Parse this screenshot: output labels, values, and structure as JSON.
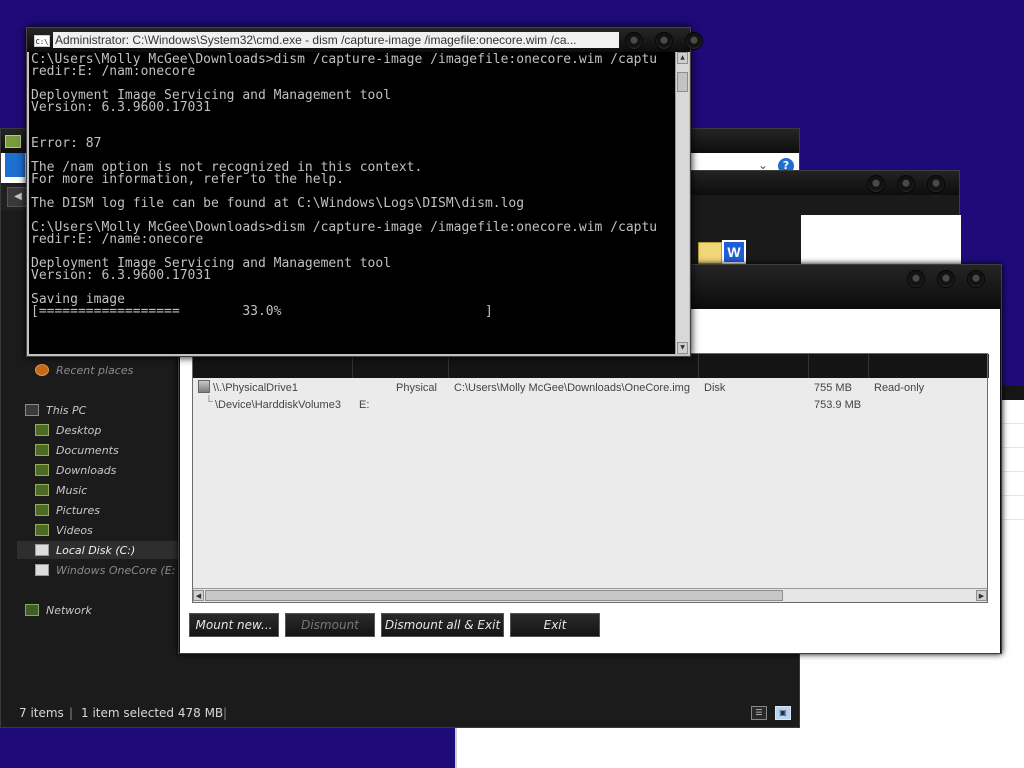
{
  "cmd": {
    "title": "Administrator: C:\\Windows\\System32\\cmd.exe - dism  /capture-image /imagefile:onecore.wim /ca...",
    "icon_label": "C:\\",
    "lines": [
      "C:\\Users\\Molly McGee\\Downloads>dism /capture-image /imagefile:onecore.wim /captu",
      "redir:E: /nam:onecore",
      "",
      "Deployment Image Servicing and Management tool",
      "Version: 6.3.9600.17031",
      "",
      "",
      "Error: 87",
      "",
      "The /nam option is not recognized in this context.",
      "For more information, refer to the help.",
      "",
      "The DISM log file can be found at C:\\Windows\\Logs\\DISM\\dism.log",
      "",
      "C:\\Users\\Molly McGee\\Downloads>dism /capture-image /imagefile:onecore.wim /captu",
      "redir:E: /name:onecore",
      "",
      "Deployment Image Servicing and Management tool",
      "Version: 6.3.9600.17031",
      "",
      "Saving image",
      "[==================        33.0%                          ]"
    ],
    "progress": 0.33
  },
  "explorer": {
    "ribbon_help": "?",
    "nav": {
      "recent": "Recent places",
      "this_pc": "This PC",
      "desktop": "Desktop",
      "documents": "Documents",
      "downloads": "Downloads",
      "music": "Music",
      "pictures": "Pictures",
      "videos": "Videos",
      "local_disk": "Local Disk (C:)",
      "onecore": "Windows OneCore (E:",
      "network": "Network"
    },
    "status": {
      "items": "7 items",
      "selected": "1 item selected  478 MB"
    }
  },
  "mount": {
    "rows": [
      {
        "name": "\\\\.\\PhysicalDrive1",
        "type": "Physical",
        "path": "C:\\Users\\Molly McGee\\Downloads\\OneCore.img",
        "kind": "Disk",
        "size": "755 MB",
        "mode": "Read-only"
      },
      {
        "name": "\\Device\\HarddiskVolume3",
        "drive": "E:",
        "size": "753.9 MB"
      }
    ],
    "buttons": {
      "mount_new": "Mount new...",
      "dismount": "Dismount",
      "dismount_all": "Dismount all & Exit",
      "exit": "Exit"
    }
  },
  "colors": {
    "desktop": "#1f0a7a",
    "console_bg": "#000000",
    "console_fg": "#c0c0c0",
    "dark_chrome": "#1b1b1b",
    "accent_blue": "#1d6fd0"
  }
}
